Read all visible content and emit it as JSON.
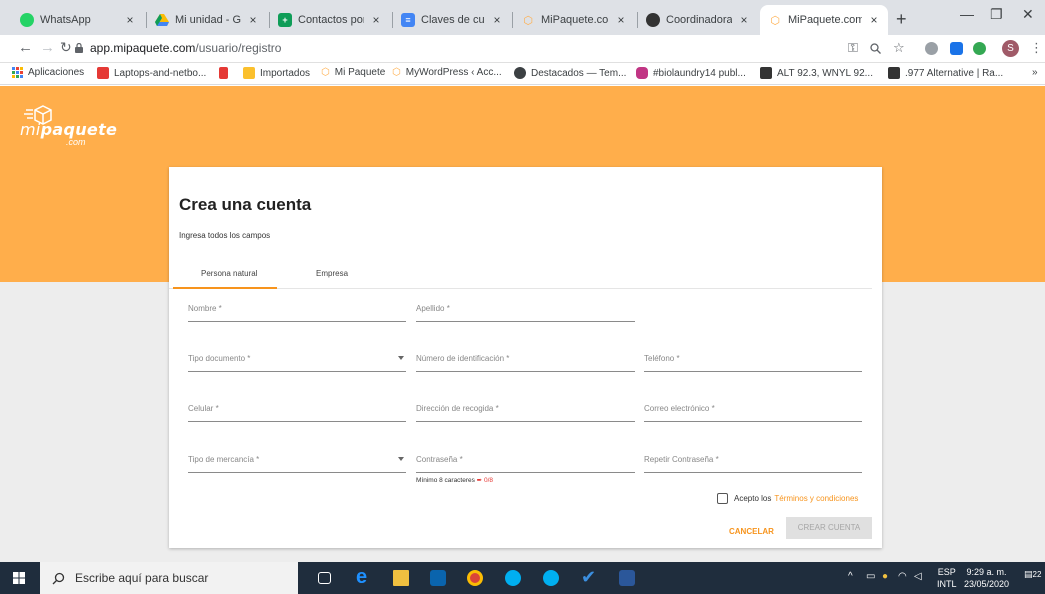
{
  "browser": {
    "tabs": [
      {
        "title": "WhatsApp",
        "icon": "whatsapp-icon",
        "color": "#25d366"
      },
      {
        "title": "Mi unidad - Goog",
        "icon": "google-drive-icon",
        "color": "#fbbc04"
      },
      {
        "title": "Contactos por trar",
        "icon": "sheets-icon",
        "color": "#0f9d58"
      },
      {
        "title": "Claves de cuentas",
        "icon": "docs-icon",
        "color": "#4285f4"
      },
      {
        "title": "MiPaquete.com",
        "icon": "mipaquete-icon",
        "color": "#ffae4b"
      },
      {
        "title": "Coordinadora: Aut",
        "icon": "coordinadora-icon",
        "color": "#333333"
      },
      {
        "title": "MiPaquete.com",
        "icon": "mipaquete-icon",
        "color": "#ffae4b",
        "active": true
      }
    ],
    "close_glyph": "×",
    "new_tab_glyph": "+",
    "url_host": "app.mipaquete.com",
    "url_path": "/usuario/registro",
    "avatar_initial": "S",
    "bookmarks": [
      {
        "label": "Aplicaciones",
        "color": "#4285f4"
      },
      {
        "label": "Laptops-and-netbo...",
        "color": "#e53935"
      },
      {
        "label": "",
        "color": "#e53935"
      },
      {
        "label": "Importados",
        "color": "#fbc02d"
      },
      {
        "label": "Mi Paquete",
        "color": "#ffae4b"
      },
      {
        "label": "MyWordPress ‹ Acc...",
        "color": "#ffae4b"
      },
      {
        "label": "Destacados — Tem...",
        "color": "#3c4043"
      },
      {
        "label": "#biolaundry14 publ...",
        "color": "#c13584"
      },
      {
        "label": "ALT 92.3, WNYL 92...",
        "color": "#333333"
      },
      {
        "label": ".977 Alternative | Ra...",
        "color": "#333333"
      }
    ],
    "more_bookmarks": "»"
  },
  "brand": {
    "logo_mi": "mi",
    "logo_paquete": "paquete",
    "logo_com": ".com",
    "accent": "#ffae4b"
  },
  "form": {
    "title": "Crea una cuenta",
    "subtitle": "Ingresa todos los campos",
    "tabs": [
      "Persona natural",
      "Empresa"
    ],
    "fields": {
      "nombre": "Nombre *",
      "apellido": "Apellido *",
      "tipo_documento": "Tipo documento *",
      "numero_id": "Número de identificación *",
      "telefono": "Teléfono *",
      "celular": "Celular *",
      "direccion": "Dirección de recogida *",
      "correo": "Correo electrónico *",
      "tipo_mercancia": "Tipo de mercancía *",
      "contrasena": "Contraseña *",
      "repetir_contrasena": "Repetir Contraseña *"
    },
    "password_hint": "Mínimo 8 caracteres",
    "password_counter": "0/8",
    "terms_prefix": "Acepto los",
    "terms_link": "Términos y condiciones",
    "cancel_label": "CANCELAR",
    "create_label": "CREAR CUENTA"
  },
  "taskbar": {
    "search_placeholder": "Escribe aquí para buscar",
    "lang_top": "ESP",
    "lang_bottom": "INTL",
    "time": "9:29 a. m.",
    "date": "23/05/2020",
    "notifications": "22"
  }
}
